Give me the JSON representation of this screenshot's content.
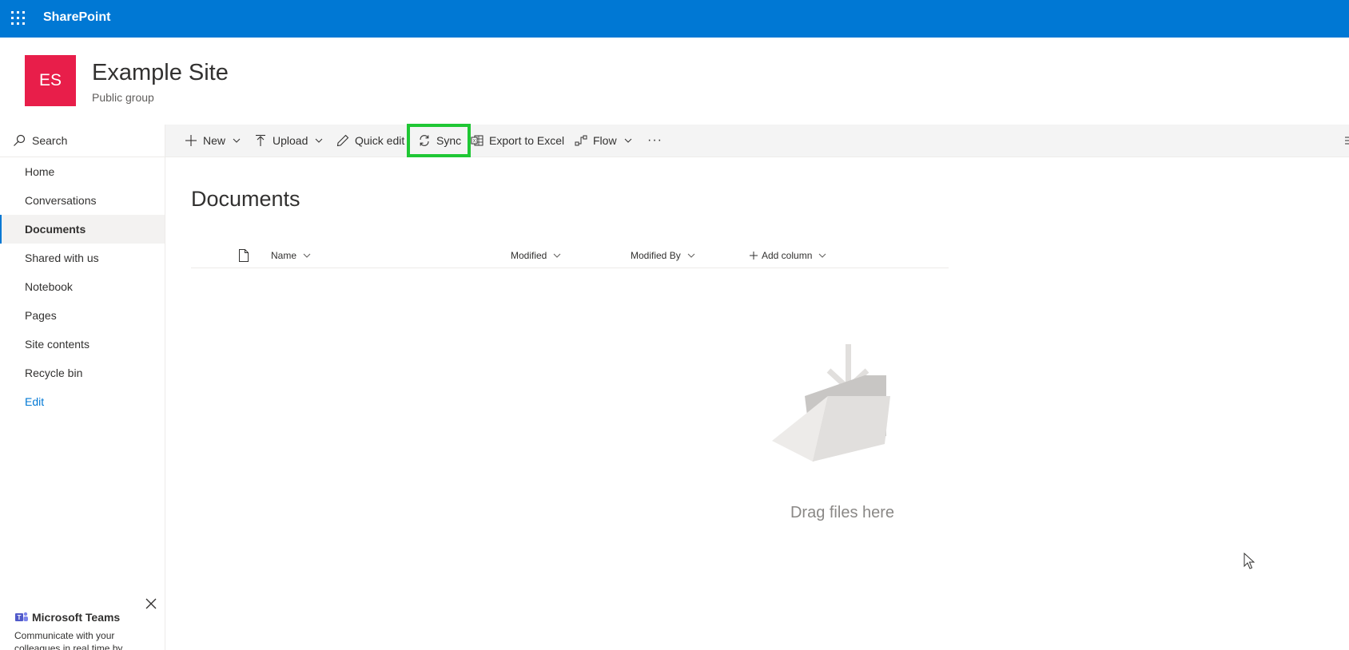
{
  "suitebar": {
    "brand": "SharePoint",
    "bg_color": "#0078d4",
    "waffle_icon": "app-launcher-icon"
  },
  "site": {
    "logo_initials": "ES",
    "logo_color": "#e81e4a",
    "title": "Example Site",
    "subtitle": "Public group"
  },
  "leftnav": {
    "search_label": "Search",
    "items": [
      {
        "label": "Home",
        "active": false
      },
      {
        "label": "Conversations",
        "active": false
      },
      {
        "label": "Documents",
        "active": true
      },
      {
        "label": "Shared with us",
        "active": false
      },
      {
        "label": "Notebook",
        "active": false
      },
      {
        "label": "Pages",
        "active": false
      },
      {
        "label": "Site contents",
        "active": false
      },
      {
        "label": "Recycle bin",
        "active": false
      }
    ],
    "edit_label": "Edit",
    "teams_promo": {
      "title": "Microsoft Teams",
      "text": "Communicate with your colleagues in real time by"
    }
  },
  "commandbar": {
    "new_label": "New",
    "upload_label": "Upload",
    "quick_edit_label": "Quick edit",
    "sync_label": "Sync",
    "export_label": "Export to Excel",
    "flow_label": "Flow",
    "more_label": "···",
    "highlight_color": "#1fc734"
  },
  "main": {
    "title": "Documents",
    "columns": {
      "name": "Name",
      "modified": "Modified",
      "modified_by": "Modified By",
      "add_column": "Add column"
    },
    "empty_text": "Drag files here"
  }
}
